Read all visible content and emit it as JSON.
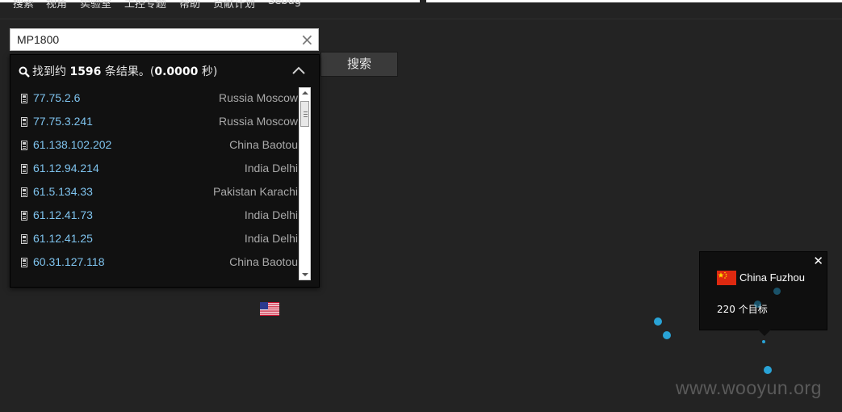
{
  "nav": {
    "items": [
      "搜索",
      "视角",
      "实验室",
      "工控专题",
      "帮助",
      "贡献计划",
      "Sebug"
    ]
  },
  "search": {
    "value": "MP1800",
    "button_label": "搜索"
  },
  "results": {
    "prefix": "找到约",
    "count": "1596",
    "middle": "条结果。(",
    "time": "0.0000",
    "suffix": "秒)",
    "rows": [
      {
        "ip": "77.75.2.6",
        "location": "Russia Moscow"
      },
      {
        "ip": "77.75.3.241",
        "location": "Russia Moscow"
      },
      {
        "ip": "61.138.102.202",
        "location": "China Baotou"
      },
      {
        "ip": "61.12.94.214",
        "location": "India Delhi"
      },
      {
        "ip": "61.5.134.33",
        "location": "Pakistan Karachi"
      },
      {
        "ip": "61.12.41.73",
        "location": "India Delhi"
      },
      {
        "ip": "61.12.41.25",
        "location": "India Delhi"
      },
      {
        "ip": "60.31.127.118",
        "location": "China Baotou"
      }
    ]
  },
  "popup": {
    "city": "China Fuzhou",
    "count_text": "220 个目标"
  },
  "watermark": "www.wooyun.org",
  "colors": {
    "background": "#232323",
    "ip_link": "#7fc4ef",
    "map_dot": "#29a3d6"
  }
}
